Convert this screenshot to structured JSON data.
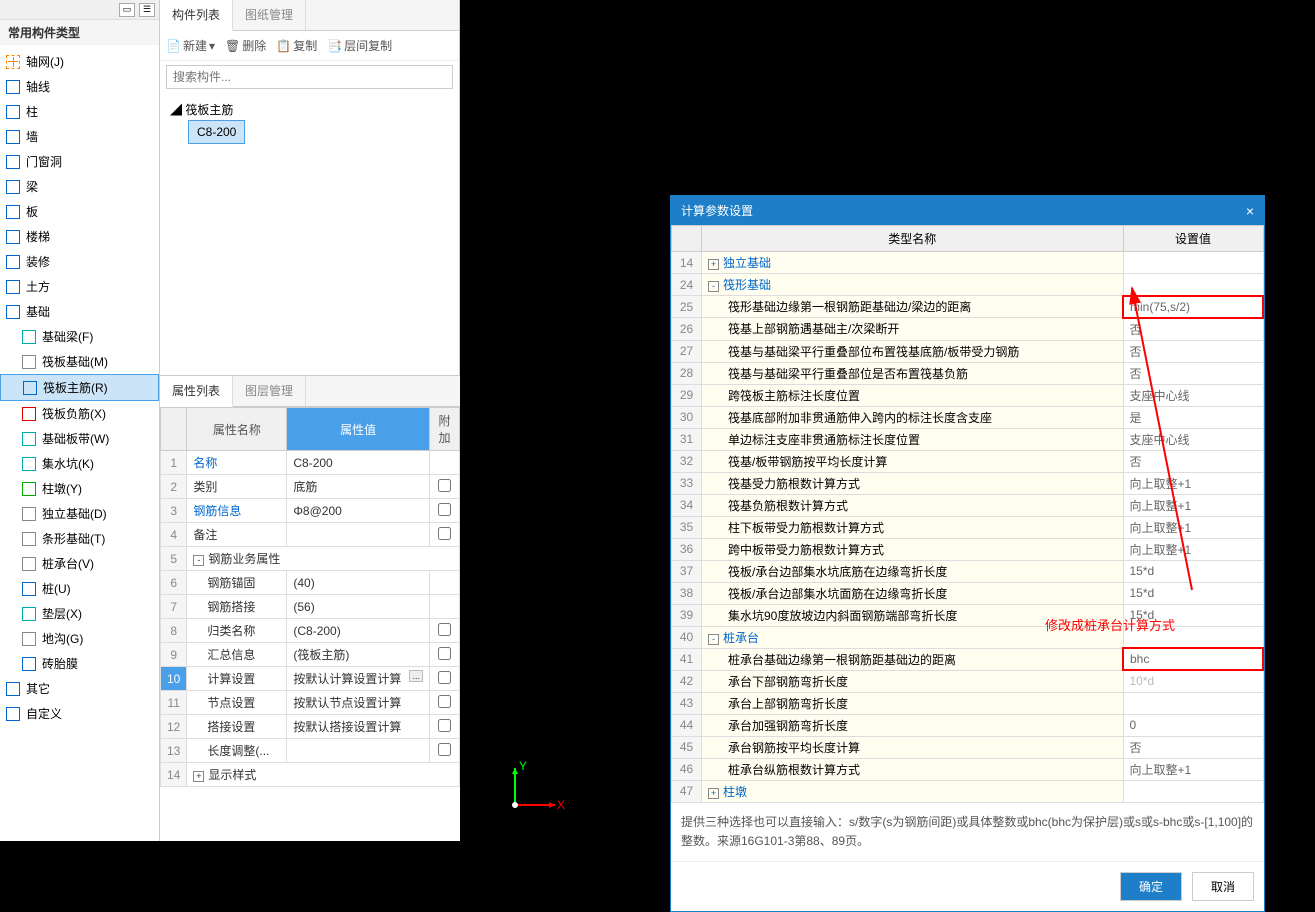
{
  "left": {
    "header": "常用构件类型",
    "items": [
      {
        "label": "轴网(J)",
        "icon": "grid"
      },
      {
        "label": "轴线",
        "icon": "blue",
        "group": true
      },
      {
        "label": "柱",
        "icon": "blue",
        "group": true
      },
      {
        "label": "墙",
        "icon": "blue",
        "group": true
      },
      {
        "label": "门窗洞",
        "icon": "blue",
        "group": true
      },
      {
        "label": "梁",
        "icon": "blue",
        "group": true
      },
      {
        "label": "板",
        "icon": "blue",
        "group": true
      },
      {
        "label": "楼梯",
        "icon": "blue",
        "group": true
      },
      {
        "label": "装修",
        "icon": "blue",
        "group": true
      },
      {
        "label": "土方",
        "icon": "blue",
        "group": true
      },
      {
        "label": "基础",
        "icon": "blue",
        "group": true,
        "open": true
      },
      {
        "label": "基础梁(F)",
        "icon": "teal",
        "indent": true
      },
      {
        "label": "筏板基础(M)",
        "icon": "gray",
        "indent": true
      },
      {
        "label": "筏板主筋(R)",
        "icon": "blue",
        "indent": true,
        "selected": true
      },
      {
        "label": "筏板负筋(X)",
        "icon": "red",
        "indent": true
      },
      {
        "label": "基础板带(W)",
        "icon": "teal",
        "indent": true
      },
      {
        "label": "集水坑(K)",
        "icon": "teal",
        "indent": true
      },
      {
        "label": "柱墩(Y)",
        "icon": "green",
        "indent": true
      },
      {
        "label": "独立基础(D)",
        "icon": "gray",
        "indent": true
      },
      {
        "label": "条形基础(T)",
        "icon": "gray",
        "indent": true
      },
      {
        "label": "桩承台(V)",
        "icon": "gray",
        "indent": true
      },
      {
        "label": "桩(U)",
        "icon": "blue",
        "indent": true
      },
      {
        "label": "垫层(X)",
        "icon": "teal",
        "indent": true
      },
      {
        "label": "地沟(G)",
        "icon": "gray",
        "indent": true
      },
      {
        "label": "砖胎膜",
        "icon": "blue",
        "indent": true
      },
      {
        "label": "其它",
        "icon": "blue",
        "group": true
      },
      {
        "label": "自定义",
        "icon": "blue",
        "group": true
      }
    ]
  },
  "mid": {
    "tabs": {
      "a": "构件列表",
      "b": "图纸管理"
    },
    "toolbar": {
      "new": "新建",
      "del": "删除",
      "copy": "复制",
      "floor": "层间复制"
    },
    "search_placeholder": "搜索构件...",
    "tree_parent": "筏板主筋",
    "tree_child": "C8-200"
  },
  "prop": {
    "tabs": {
      "a": "属性列表",
      "b": "图层管理"
    },
    "headers": {
      "name": "属性名称",
      "val": "属性值",
      "extra": "附加"
    },
    "rows": [
      {
        "n": "1",
        "name": "名称",
        "val": "C8-200",
        "link": true
      },
      {
        "n": "2",
        "name": "类别",
        "val": "底筋",
        "chk": true
      },
      {
        "n": "3",
        "name": "钢筋信息",
        "val": "Φ8@200",
        "link": true,
        "chk": true
      },
      {
        "n": "4",
        "name": "备注",
        "val": "",
        "chk": true
      },
      {
        "n": "5",
        "name": "钢筋业务属性",
        "expand": "-"
      },
      {
        "n": "6",
        "name": "钢筋锚固",
        "val": "(40)",
        "indent": true
      },
      {
        "n": "7",
        "name": "钢筋搭接",
        "val": "(56)",
        "indent": true
      },
      {
        "n": "8",
        "name": "归类名称",
        "val": "(C8-200)",
        "indent": true,
        "chk": true
      },
      {
        "n": "9",
        "name": "汇总信息",
        "val": "(筏板主筋)",
        "indent": true,
        "chk": true
      },
      {
        "n": "10",
        "name": "计算设置",
        "val": "按默认计算设置计算",
        "indent": true,
        "hl": true,
        "ellipsis": true,
        "chk": true
      },
      {
        "n": "11",
        "name": "节点设置",
        "val": "按默认节点设置计算",
        "indent": true,
        "chk": true
      },
      {
        "n": "12",
        "name": "搭接设置",
        "val": "按默认搭接设置计算",
        "indent": true,
        "chk": true
      },
      {
        "n": "13",
        "name": "长度调整(...",
        "val": "",
        "indent": true,
        "chk": true
      },
      {
        "n": "14",
        "name": "显示样式",
        "expand": "+"
      }
    ]
  },
  "dialog": {
    "title": "计算参数设置",
    "headers": {
      "name": "类型名称",
      "val": "设置值"
    },
    "rows": [
      {
        "n": "14",
        "name": "独立基础",
        "group": true,
        "expand": "+"
      },
      {
        "n": "24",
        "name": "筏形基础",
        "group": true,
        "expand": "-"
      },
      {
        "n": "25",
        "name": "筏形基础边缘第一根钢筋距基础边/梁边的距离",
        "val": "min(75,s/2)",
        "hl": true
      },
      {
        "n": "26",
        "name": "筏基上部钢筋遇基础主/次梁断开",
        "val": "否"
      },
      {
        "n": "27",
        "name": "筏基与基础梁平行重叠部位布置筏基底筋/板带受力钢筋",
        "val": "否"
      },
      {
        "n": "28",
        "name": "筏基与基础梁平行重叠部位是否布置筏基负筋",
        "val": "否"
      },
      {
        "n": "29",
        "name": "跨筏板主筋标注长度位置",
        "val": "支座中心线"
      },
      {
        "n": "30",
        "name": "筏基底部附加非贯通筋伸入跨内的标注长度含支座",
        "val": "是"
      },
      {
        "n": "31",
        "name": "单边标注支座非贯通筋标注长度位置",
        "val": "支座中心线"
      },
      {
        "n": "32",
        "name": "筏基/板带钢筋按平均长度计算",
        "val": "否"
      },
      {
        "n": "33",
        "name": "筏基受力筋根数计算方式",
        "val": "向上取整+1"
      },
      {
        "n": "34",
        "name": "筏基负筋根数计算方式",
        "val": "向上取整+1"
      },
      {
        "n": "35",
        "name": "柱下板带受力筋根数计算方式",
        "val": "向上取整+1"
      },
      {
        "n": "36",
        "name": "跨中板带受力筋根数计算方式",
        "val": "向上取整+1"
      },
      {
        "n": "37",
        "name": "筏板/承台边部集水坑底筋在边缘弯折长度",
        "val": "15*d"
      },
      {
        "n": "38",
        "name": "筏板/承台边部集水坑面筋在边缘弯折长度",
        "val": "15*d"
      },
      {
        "n": "39",
        "name": "集水坑90度放坡边内斜面钢筋端部弯折长度",
        "val": "15*d"
      },
      {
        "n": "40",
        "name": "桩承台",
        "group": true,
        "expand": "-"
      },
      {
        "n": "41",
        "name": "桩承台基础边缘第一根钢筋距基础边的距离",
        "val": "bhc",
        "hl": true
      },
      {
        "n": "42",
        "name": "承台下部钢筋弯折长度",
        "val": "10*d",
        "dim": true
      },
      {
        "n": "43",
        "name": "承台上部钢筋弯折长度",
        "val": ""
      },
      {
        "n": "44",
        "name": "承台加强钢筋弯折长度",
        "val": "0"
      },
      {
        "n": "45",
        "name": "承台钢筋按平均长度计算",
        "val": "否"
      },
      {
        "n": "46",
        "name": "桩承台纵筋根数计算方式",
        "val": "向上取整+1"
      },
      {
        "n": "47",
        "name": "柱墩",
        "group": true,
        "expand": "+"
      }
    ],
    "footer": "提供三种选择也可以直接输入：s/数字(s为钢筋间距)或具体整数或bhc(bhc为保护层)或s或s-bhc或s-[1,100]的整数。来源16G101-3第88、89页。",
    "ok": "确定",
    "cancel": "取消"
  },
  "annotation": "修改成桩承台计算方式",
  "axis": {
    "x": "X",
    "y": "Y"
  }
}
